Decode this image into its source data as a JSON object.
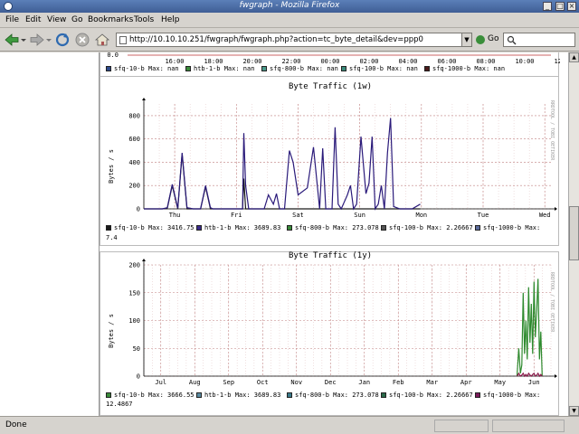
{
  "window": {
    "title": "fwgraph - Mozilla Firefox"
  },
  "menu": [
    "File",
    "Edit",
    "View",
    "Go",
    "Bookmarks",
    "Tools",
    "Help"
  ],
  "address": {
    "url": "http://10.10.10.251/fwgraph/fwgraph.php?action=tc_byte_detail&dev=ppp0",
    "go_label": "Go"
  },
  "status": {
    "text": "Done"
  },
  "top_graph": {
    "ytick": "0.0",
    "x_ticks": [
      "16:00",
      "18:00",
      "20:00",
      "22:00",
      "00:00",
      "02:00",
      "04:00",
      "06:00",
      "08:00",
      "10:00",
      "12:00"
    ],
    "legend": [
      {
        "name": "sfq-10-b",
        "text": "Max:  nan",
        "color": "#2e4a8a"
      },
      {
        "name": "htb-1-b",
        "text": "Max:  nan",
        "color": "#3a8a3a"
      },
      {
        "name": "sfq-800-b",
        "text": "Max:  nan",
        "color": "#4a9a8a"
      },
      {
        "name": "sfq-100-b",
        "text": "Max:  nan",
        "color": "#3a8a7a"
      },
      {
        "name": "sfq-1000-b",
        "text": "Max:  nan",
        "color": "#4a1a1a"
      }
    ]
  },
  "chart_data": [
    {
      "type": "line",
      "title": "Byte Traffic (1w)",
      "ylabel": "Bytes / s",
      "ylim": [
        0,
        900
      ],
      "yticks": [
        0,
        200,
        400,
        600,
        800
      ],
      "xticks": [
        "Thu",
        "Fri",
        "Sat",
        "Sun",
        "Mon",
        "Tue",
        "Wed"
      ],
      "grid": true,
      "watermark": "RRDTOOL / TOBI OETIKER",
      "x": [
        0.0,
        0.3,
        0.38,
        0.46,
        0.55,
        0.62,
        0.7,
        0.8,
        0.92,
        1.0,
        1.08,
        1.12,
        1.18,
        1.22,
        1.3,
        1.5,
        1.6,
        1.62,
        1.65,
        1.7,
        1.75,
        1.8,
        1.95,
        2.02,
        2.1,
        2.15,
        2.2,
        2.28,
        2.36,
        2.42,
        2.5,
        2.65,
        2.75,
        2.85,
        2.9,
        2.95,
        3.05,
        3.1,
        3.15,
        3.2,
        3.3,
        3.35,
        3.4,
        3.45,
        3.52,
        3.6,
        3.65,
        3.7,
        3.75,
        3.8,
        3.85,
        3.9,
        3.95,
        4.0,
        4.05,
        4.15,
        4.35,
        4.48
      ],
      "series": [
        {
          "name": "sfq-10-b",
          "color": "#1a1a1a",
          "values": [
            0,
            0,
            5,
            200,
            0,
            470,
            0,
            0,
            0,
            190,
            0,
            0,
            0,
            0,
            0,
            0,
            0,
            260,
            0,
            0,
            0,
            0,
            0,
            0,
            0,
            0,
            0,
            0,
            0,
            0,
            0,
            0,
            0,
            0,
            0,
            0,
            0,
            0,
            0,
            0,
            0,
            0,
            0,
            0,
            0,
            0,
            0,
            0,
            0,
            0,
            0,
            0,
            0,
            0,
            0,
            0,
            0,
            0
          ]
        },
        {
          "name": "htb-1-b",
          "color": "#2a1a7a",
          "values": [
            0,
            0,
            10,
            210,
            5,
            480,
            10,
            0,
            0,
            200,
            10,
            0,
            0,
            0,
            0,
            0,
            0,
            650,
            200,
            0,
            0,
            0,
            0,
            120,
            40,
            130,
            0,
            0,
            500,
            400,
            120,
            180,
            530,
            0,
            520,
            0,
            0,
            700,
            40,
            0,
            120,
            200,
            0,
            40,
            620,
            130,
            220,
            620,
            0,
            40,
            200,
            0,
            480,
            780,
            20,
            0,
            0,
            40
          ]
        }
      ],
      "legend": [
        {
          "name": "sfq-10-b",
          "text": "Max:  3416.75",
          "color": "#1a1a1a"
        },
        {
          "name": "htb-1-b",
          "text": "Max:  3689.83",
          "color": "#3a2a8a"
        },
        {
          "name": "sfq-800-b",
          "text": "Max:  273.078",
          "color": "#3a8a3a"
        },
        {
          "name": "sfq-100-b",
          "text": "Max:  2.26667",
          "color": "#555555"
        },
        {
          "name": "sfq-1000-b",
          "text": "Max:",
          "color": "#5a6a9a"
        }
      ],
      "legend_wrap": "7.4"
    },
    {
      "type": "line",
      "title": "Byte Traffic (1y)",
      "ylabel": "Bytes / s",
      "ylim": [
        0,
        200
      ],
      "yticks": [
        0,
        50,
        100,
        150,
        200
      ],
      "xticks": [
        "Jul",
        "Aug",
        "Sep",
        "Oct",
        "Nov",
        "Dec",
        "Jan",
        "Feb",
        "Mar",
        "Apr",
        "May",
        "Jun"
      ],
      "grid": true,
      "watermark": "RRDTOOL / TOBI OETIKER",
      "x": [
        11.0,
        11.05,
        11.1,
        11.14,
        11.18,
        11.22,
        11.26,
        11.3,
        11.34,
        11.38,
        11.42,
        11.46,
        11.5,
        11.54,
        11.58,
        11.62,
        11.66,
        11.7,
        11.74
      ],
      "series": [
        {
          "name": "sfq-10-b",
          "color": "#2e8a2e",
          "values": [
            0,
            50,
            5,
            20,
            150,
            40,
            100,
            30,
            160,
            60,
            130,
            40,
            170,
            70,
            120,
            175,
            30,
            80,
            0
          ]
        },
        {
          "name": "htb-1-b",
          "color": "#8a1a4a",
          "values": [
            0,
            5,
            0,
            2,
            5,
            0,
            3,
            0,
            5,
            2,
            0,
            3,
            5,
            0,
            2,
            5,
            0,
            3,
            0
          ]
        }
      ],
      "legend": [
        {
          "name": "sfq-10-b",
          "text": "Max:  3666.55",
          "color": "#3a8a3a"
        },
        {
          "name": "htb-1-b",
          "text": "Max:  3689.83",
          "color": "#5a8aa0"
        },
        {
          "name": "sfq-800-b",
          "text": "Max:  273.078",
          "color": "#3a7a8a"
        },
        {
          "name": "sfq-100-b",
          "text": "Max:  2.26667",
          "color": "#2a6a4a"
        },
        {
          "name": "sfq-1000-b",
          "text": "Max:",
          "color": "#7a1a5a"
        }
      ],
      "legend_wrap": "12.4867"
    }
  ]
}
